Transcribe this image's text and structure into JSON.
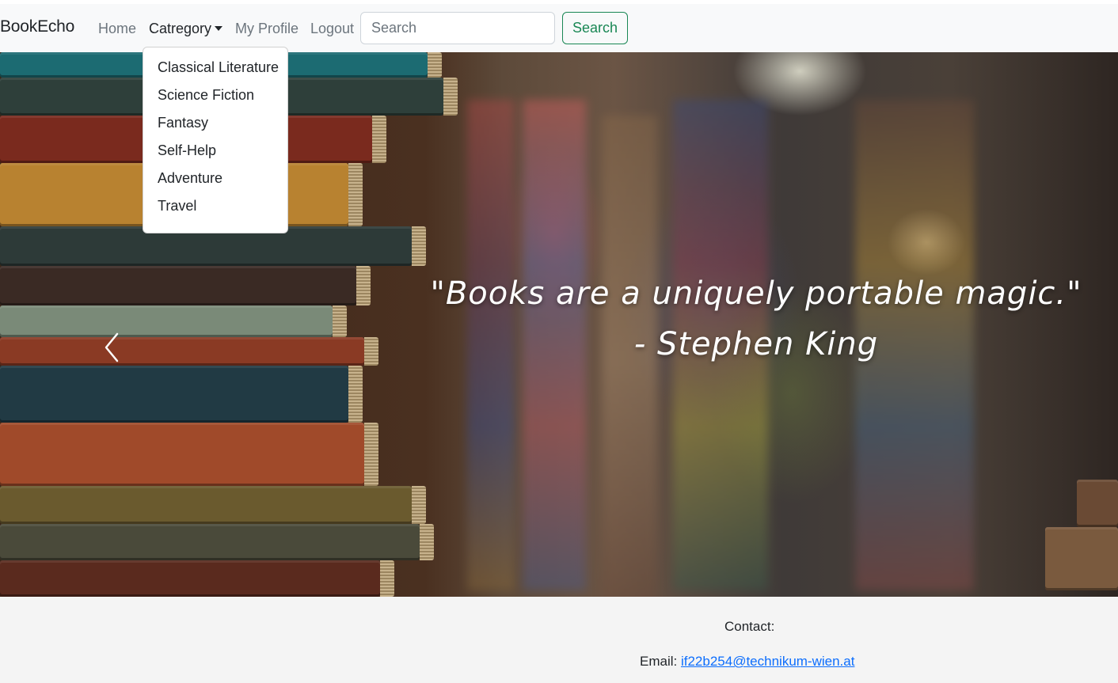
{
  "navbar": {
    "brand": "BookEcho",
    "links": {
      "home": "Home",
      "category": "Catregory",
      "profile": "My Profile",
      "logout": "Logout"
    },
    "search": {
      "placeholder": "Search",
      "button_label": "Search"
    }
  },
  "dropdown": {
    "items": [
      "Classical Literature",
      "Science Fiction",
      "Fantasy",
      "Self-Help",
      "Adventure",
      "Travel"
    ]
  },
  "carousel": {
    "quote_line1": "\"Books are a uniquely portable magic.\"",
    "quote_line2": "- Stephen King",
    "prev_icon": "chevron-left-icon"
  },
  "footer": {
    "contact_label": "Contact:",
    "email_label": "Email:",
    "email": "if22b254@technikum-wien.at"
  },
  "colors": {
    "navbar_bg": "#f8f9fa",
    "success": "#198754",
    "link": "#0d6efd"
  }
}
